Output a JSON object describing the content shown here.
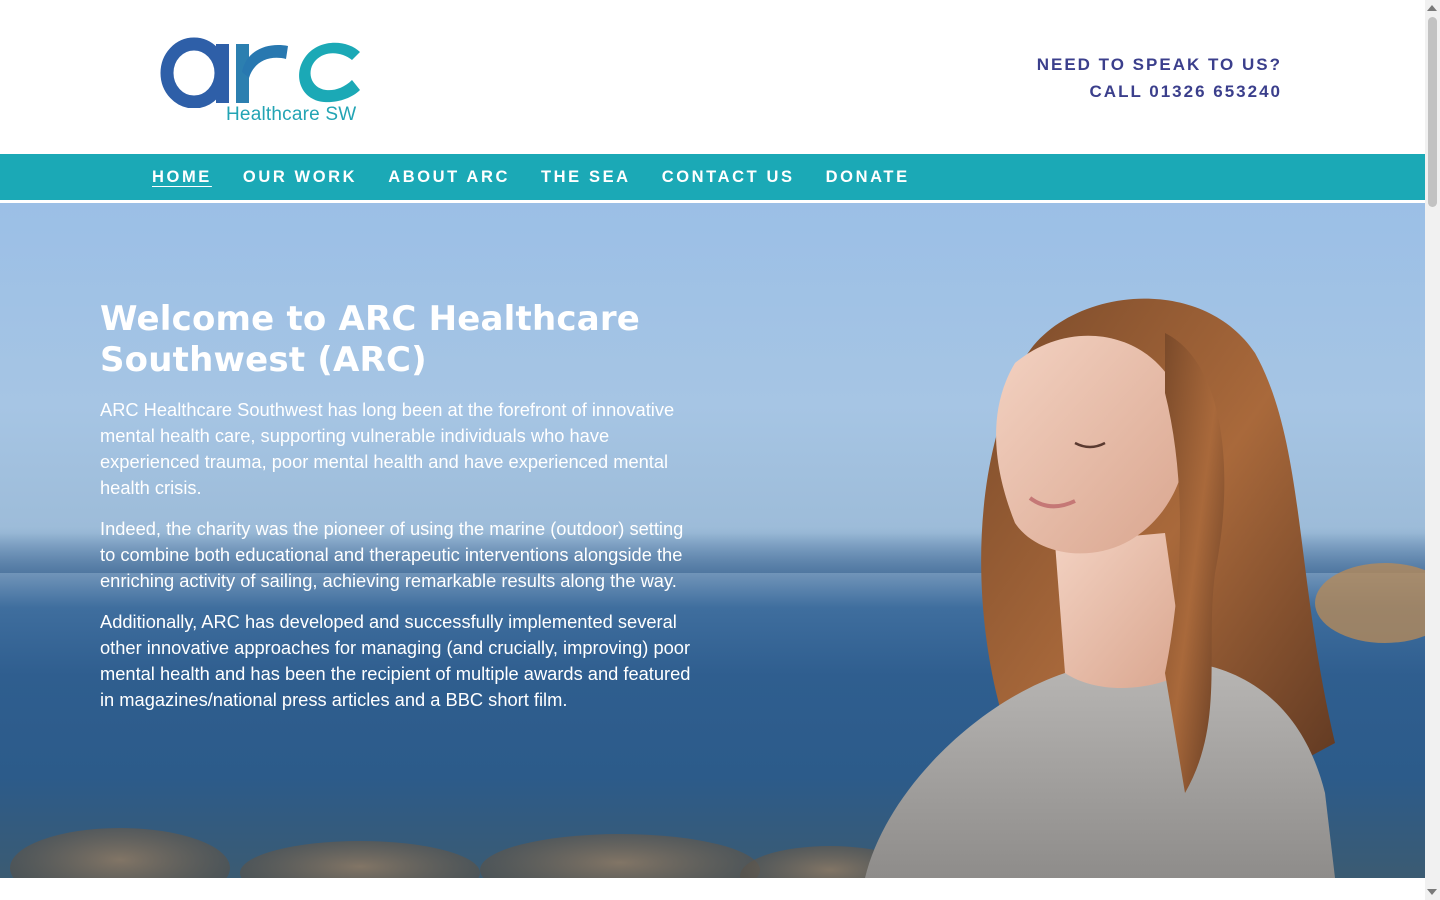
{
  "header": {
    "logo": {
      "wordmark": "arc",
      "subtitle": "Healthcare SW",
      "colors": {
        "dark_blue": "#2e5fa8",
        "teal": "#23a4b4"
      }
    },
    "cta": {
      "line1": "NEED TO SPEAK TO US?",
      "line2": "CALL 01326 653240"
    }
  },
  "nav": {
    "items": [
      {
        "label": "HOME",
        "active": true
      },
      {
        "label": "OUR WORK",
        "active": false
      },
      {
        "label": "ABOUT ARC",
        "active": false
      },
      {
        "label": "THE SEA",
        "active": false
      },
      {
        "label": "CONTACT US",
        "active": false
      },
      {
        "label": "DONATE",
        "active": false
      }
    ],
    "background": "#1ba9b6"
  },
  "hero": {
    "title": "Welcome to ARC Healthcare Southwest (ARC)",
    "paragraphs": [
      "ARC Healthcare Southwest has long been at the forefront of innovative mental health care, supporting vulnerable individuals who have experienced trauma, poor mental health and have experienced mental health crisis.",
      "Indeed, the charity was the pioneer of using the marine (outdoor) setting to combine both educational and therapeutic interventions alongside the enriching activity of sailing, achieving remarkable results along the way.",
      "Additionally, ARC has developed and successfully implemented several other innovative approaches for managing (and crucially, improving) poor mental health and has been the recipient of multiple awards and featured in magazines/national press articles and a BBC short film."
    ],
    "image_subject": "woman-by-the-sea"
  }
}
